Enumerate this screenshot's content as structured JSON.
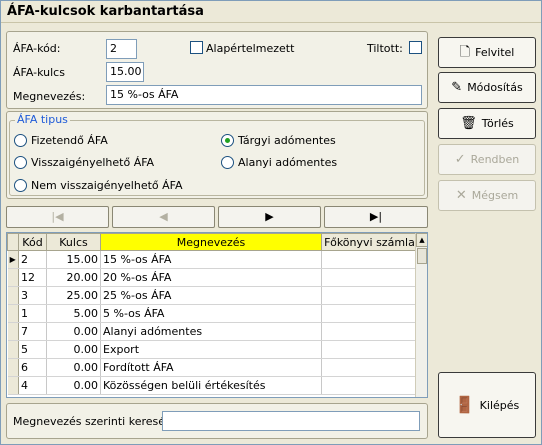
{
  "window": {
    "title": "ÁFA-kulcsok karbantartása"
  },
  "form": {
    "code_label": "ÁFA-kód:",
    "code_value": "2",
    "rate_label": "ÁFA-kulcs",
    "rate_value": "15.00",
    "name_label": "Megnevezés:",
    "name_value": "15 %-os ÁFA",
    "default_label": "Alapértelmezett",
    "default_checked": false,
    "disabled_label": "Tiltott:",
    "disabled_checked": false
  },
  "vat_type": {
    "legend": "ÁFA tipus",
    "options": [
      {
        "label": "Fizetendő ÁFA",
        "checked": false
      },
      {
        "label": "Visszaigényelhető ÁFA",
        "checked": false
      },
      {
        "label": "Nem visszaigényelhető ÁFA",
        "checked": false
      },
      {
        "label": "Tárgyi adómentes",
        "checked": true
      },
      {
        "label": "Alanyi adómentes",
        "checked": false
      }
    ]
  },
  "navigator": {
    "first": "|◀",
    "prev": "◀",
    "next": "▶",
    "last": "▶|"
  },
  "table": {
    "headers": [
      "Kód",
      "Kulcs",
      "Megnevezés",
      "Főkönyvi számla"
    ],
    "rows": [
      {
        "code": "2",
        "rate": "15.00",
        "name": "15 %-os ÁFA",
        "account": ""
      },
      {
        "code": "12",
        "rate": "20.00",
        "name": "20 %-os ÁFA",
        "account": ""
      },
      {
        "code": "3",
        "rate": "25.00",
        "name": "25 %-os ÁFA",
        "account": ""
      },
      {
        "code": "1",
        "rate": "5.00",
        "name": "5 %-os ÁFA",
        "account": ""
      },
      {
        "code": "7",
        "rate": "0.00",
        "name": "Alanyi adómentes",
        "account": ""
      },
      {
        "code": "5",
        "rate": "0.00",
        "name": "Export",
        "account": ""
      },
      {
        "code": "6",
        "rate": "0.00",
        "name": "Fordított ÁFA",
        "account": ""
      },
      {
        "code": "4",
        "rate": "0.00",
        "name": "Közösségen belüli értékesítés",
        "account": ""
      }
    ]
  },
  "search": {
    "label": "Megnevezés szerinti keresés",
    "value": ""
  },
  "buttons": {
    "new": {
      "label": "Felvitel",
      "icon": "new-document-icon"
    },
    "modify": {
      "label": "Módosítás",
      "icon": "edit-icon"
    },
    "delete": {
      "label": "Törlés",
      "icon": "trash-icon"
    },
    "save": {
      "label": "Rendben",
      "icon": "check-icon"
    },
    "cancel": {
      "label": "Mégsem",
      "icon": "cross-icon"
    },
    "exit": {
      "label": "Kilépés",
      "icon": "exit-door-icon"
    }
  }
}
